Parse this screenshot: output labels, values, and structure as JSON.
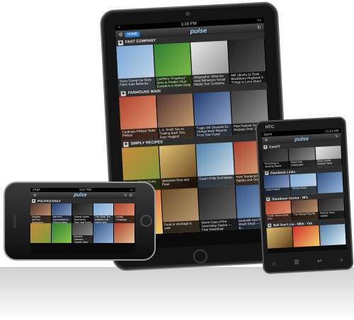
{
  "tablet": {
    "status_time": "1:34 PM",
    "logo": "pulse",
    "home_label": "HOME",
    "sections": [
      {
        "title": "FAST COMPANY",
        "tiles": [
          {
            "caption": "Scary Turing Car Body Fuller Eats Batteries",
            "color": "c0"
          },
          {
            "caption": "DARPA's \"Prophecy\" Aims to Predict Virus Evolution in Water Drop",
            "color": "c1"
          },
          {
            "caption": "Infographic: What Do User Behaviors Social Media Your Company Homepage",
            "color": "c3"
          },
          {
            "caption": "Will Ubuntu 11 Rock BlackBerry Playbook 3 Things to Love About Enterprise",
            "color": "c4"
          }
        ]
      },
      {
        "title": "FANHOUSE MAIN",
        "tiles": [
          {
            "caption": "Cardinals Phillips' Rider Phillips",
            "color": "c5"
          },
          {
            "caption": "L.A. Smith Set on Trading Back Tom, Says Huggins' Executive",
            "color": "c6"
          },
          {
            "caption": "Tragic Gill Divandio Ex-Vikings Back Returns From Star Panel",
            "color": "c7"
          },
          {
            "caption": "Pats Patriots Say Surpass Over 1-2 Start",
            "color": "c2"
          }
        ]
      },
      {
        "title": "SIMPLY RECIPES",
        "tiles": [
          {
            "caption": "Eggplant Green Curry",
            "color": "c8"
          },
          {
            "caption": "Jamaican Rice and Peas",
            "color": "c9"
          },
          {
            "caption": "Green Chile Enchiladas",
            "color": "c10"
          },
          {
            "caption": "Pork Tenderloin with Apples and Onions",
            "color": "c11"
          }
        ]
      },
      {
        "title": "",
        "tiles": [
          {
            "caption": "",
            "color": "c12"
          },
          {
            "caption": "Food or shortage is over",
            "color": "c13"
          },
          {
            "caption": "Worst Case of the Doomsday Device — Free Download",
            "color": "c14"
          },
          {
            "caption": "coverstill.com Rob Wash Dead — Images &...",
            "color": "c15"
          }
        ]
      }
    ]
  },
  "iphone": {
    "carrier": "AT&T",
    "status_time": "3:47 PM",
    "logo": "pulse",
    "sections": [
      {
        "title": "POLITICS DAILY",
        "tiles": [
          {
            "caption": "Meghan McCain: Newcomer Seek",
            "color": "c6"
          },
          {
            "caption": "Maxine's Accomplished: Obama Ideas",
            "color": "c7"
          },
          {
            "caption": "Obama Issues Sponsored Town Hall Event",
            "color": "c4"
          },
          {
            "caption": "The Circle Tea Activists Call Inches and Sense",
            "color": "c0"
          },
          {
            "caption": "Locally Campaign",
            "color": "c5"
          }
        ]
      },
      {
        "title": "",
        "tiles": [
          {
            "caption": "",
            "color": "c8"
          },
          {
            "caption": "",
            "color": "c1"
          },
          {
            "caption": "Michelle Obama's 'Charity' Idea",
            "color": "c2"
          },
          {
            "caption": "",
            "color": "c15"
          },
          {
            "caption": "",
            "color": "c11"
          }
        ]
      }
    ]
  },
  "android": {
    "brand": "HTC",
    "carrier": "Sprint",
    "status_time": "11:53 AM",
    "logo": "pulse",
    "keys": [
      "⌂",
      "☰",
      "↩",
      "⌕"
    ],
    "sections": [
      {
        "title": "Core77",
        "tiles": [
          {
            "caption": "Technology & Jumping Sports",
            "color": "c4"
          },
          {
            "caption": "Robot Fish Underwater",
            "color": "c2"
          },
          {
            "caption": "Shoe Leader Outdoor Gear",
            "color": "c3"
          }
        ]
      },
      {
        "title": "Facebook Links",
        "tiles": [
          {
            "caption": "Links Posted",
            "color": "c7"
          },
          {
            "caption": "Photos Share",
            "color": "c0"
          },
          {
            "caption": "",
            "color": "c15"
          }
        ]
      },
      {
        "title": "Shutdown Corner - NFL",
        "tiles": [
          {
            "caption": "Frantic News Game Over",
            "color": "c5"
          },
          {
            "caption": "The Vikings Playoffs",
            "color": "c6"
          },
          {
            "caption": "Patriots Team Update",
            "color": "c14"
          }
        ]
      },
      {
        "title": "Ball Don't Lie - NBA - Yah",
        "tiles": [
          {
            "caption": "",
            "color": "c9"
          },
          {
            "caption": "",
            "color": "c12"
          },
          {
            "caption": "",
            "color": "c10"
          }
        ]
      }
    ]
  }
}
